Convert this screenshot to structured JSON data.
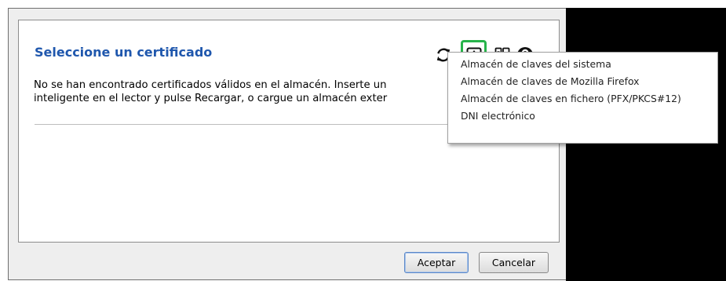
{
  "dialog": {
    "title": "Seleccione un certificado",
    "message_line1": "No se han encontrado certificados válidos en el almacén. Inserte un",
    "message_line2": "inteligente en el lector y pulse Recargar, o cargue un almacén exter",
    "toolbar": {
      "icons": [
        "reload-icon",
        "open-keystore-icon",
        "details-icon",
        "help-icon"
      ],
      "highlight_color": "#27b34a"
    },
    "keystore_menu": {
      "items": [
        "Almacén de claves del sistema",
        "Almacén de claves de Mozilla Firefox",
        "Almacén de claves en fichero (PFX/PKCS#12)",
        "DNI electrónico"
      ]
    },
    "buttons": {
      "accept_label": "Aceptar",
      "cancel_label": "Cancelar"
    },
    "colors": {
      "title": "#1f57ad",
      "background": "#eeeeee"
    }
  }
}
